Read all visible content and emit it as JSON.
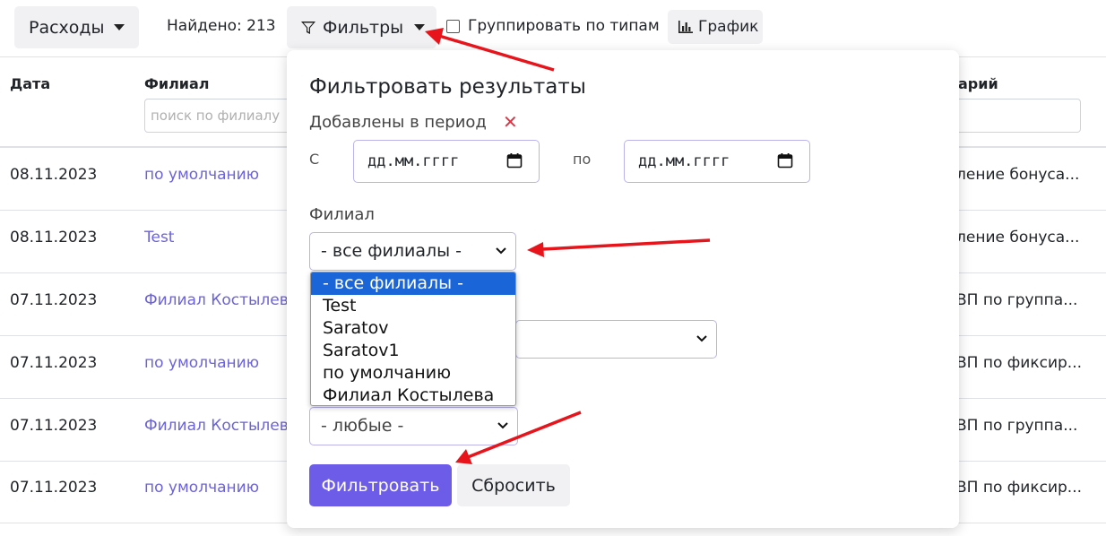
{
  "toolbar": {
    "expenses_label": "Расходы",
    "found_text": "Найдено: 213",
    "filters_label": "Фильтры",
    "group_by_type_label": "Группировать по типам",
    "group_by_type_checked": false,
    "chart_label": "График"
  },
  "table": {
    "columns": {
      "date": "Дата",
      "branch": "Филиал",
      "comment": "арий"
    },
    "branch_filter_placeholder": "поиск по филиалу",
    "rows": [
      {
        "date": "08.11.2023",
        "branch": "по умолчанию",
        "comment": "ление бонуса..."
      },
      {
        "date": "08.11.2023",
        "branch": "Test",
        "comment": "ление бонуса..."
      },
      {
        "date": "07.11.2023",
        "branch": "Филиал Костылев",
        "comment": "ВП по группа..."
      },
      {
        "date": "07.11.2023",
        "branch": "по умолчанию",
        "comment": "ВП по фиксир..."
      },
      {
        "date": "07.11.2023",
        "branch": "Филиал Костылев",
        "comment": "ВП по группа..."
      },
      {
        "date": "07.11.2023",
        "branch": "по умолчанию",
        "comment": "ВП по фиксир..."
      }
    ]
  },
  "filter_popup": {
    "title": "Фильтровать результаты",
    "period_label": "Добавлены в период",
    "period_clear_symbol": "✕",
    "from_label": "С",
    "to_label": "по",
    "date_from_placeholder": "дд.мм.гггг",
    "date_to_placeholder": "дд.мм.гггг",
    "branch_label": "Филиал",
    "branch_selected": "- все филиалы -",
    "branch_options": [
      "- все филиалы -",
      "Test",
      "Saratov",
      "Saratov1",
      "по умолчанию",
      "Филиал Костылева"
    ],
    "type_selected": "- любые -",
    "apply_label": "Фильтровать",
    "reset_label": "Сбросить"
  },
  "colors": {
    "accent": "#6c5ce7",
    "link": "#6c63d9",
    "danger": "#dc3545",
    "annotation_arrow": "#e8141b",
    "option_highlight": "#1a66d9"
  },
  "icons": {
    "filters": "funnel-icon",
    "chart": "bar-chart-icon",
    "date": "calendar-icon",
    "select": "chevron-down-icon",
    "clear": "close-icon"
  }
}
